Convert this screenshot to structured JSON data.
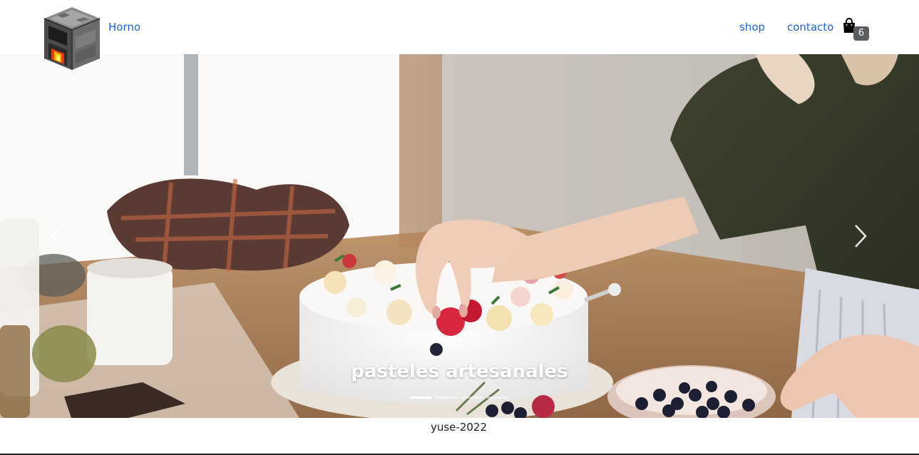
{
  "navbar": {
    "brand_text": "Horno",
    "links": [
      {
        "label": "shop"
      },
      {
        "label": "contacto"
      }
    ],
    "cart": {
      "count": "6",
      "icon": "shopping-bag-icon"
    }
  },
  "carousel": {
    "caption": "pasteles artesanales",
    "slide_count": 4,
    "active_slide": 1,
    "prev_icon": "chevron-left-icon",
    "next_icon": "chevron-right-icon"
  },
  "footer": {
    "text": "yuse-2022"
  },
  "colors": {
    "link": "#1e63d6",
    "badge": "#5a5d62",
    "caption": "#ffffff"
  }
}
